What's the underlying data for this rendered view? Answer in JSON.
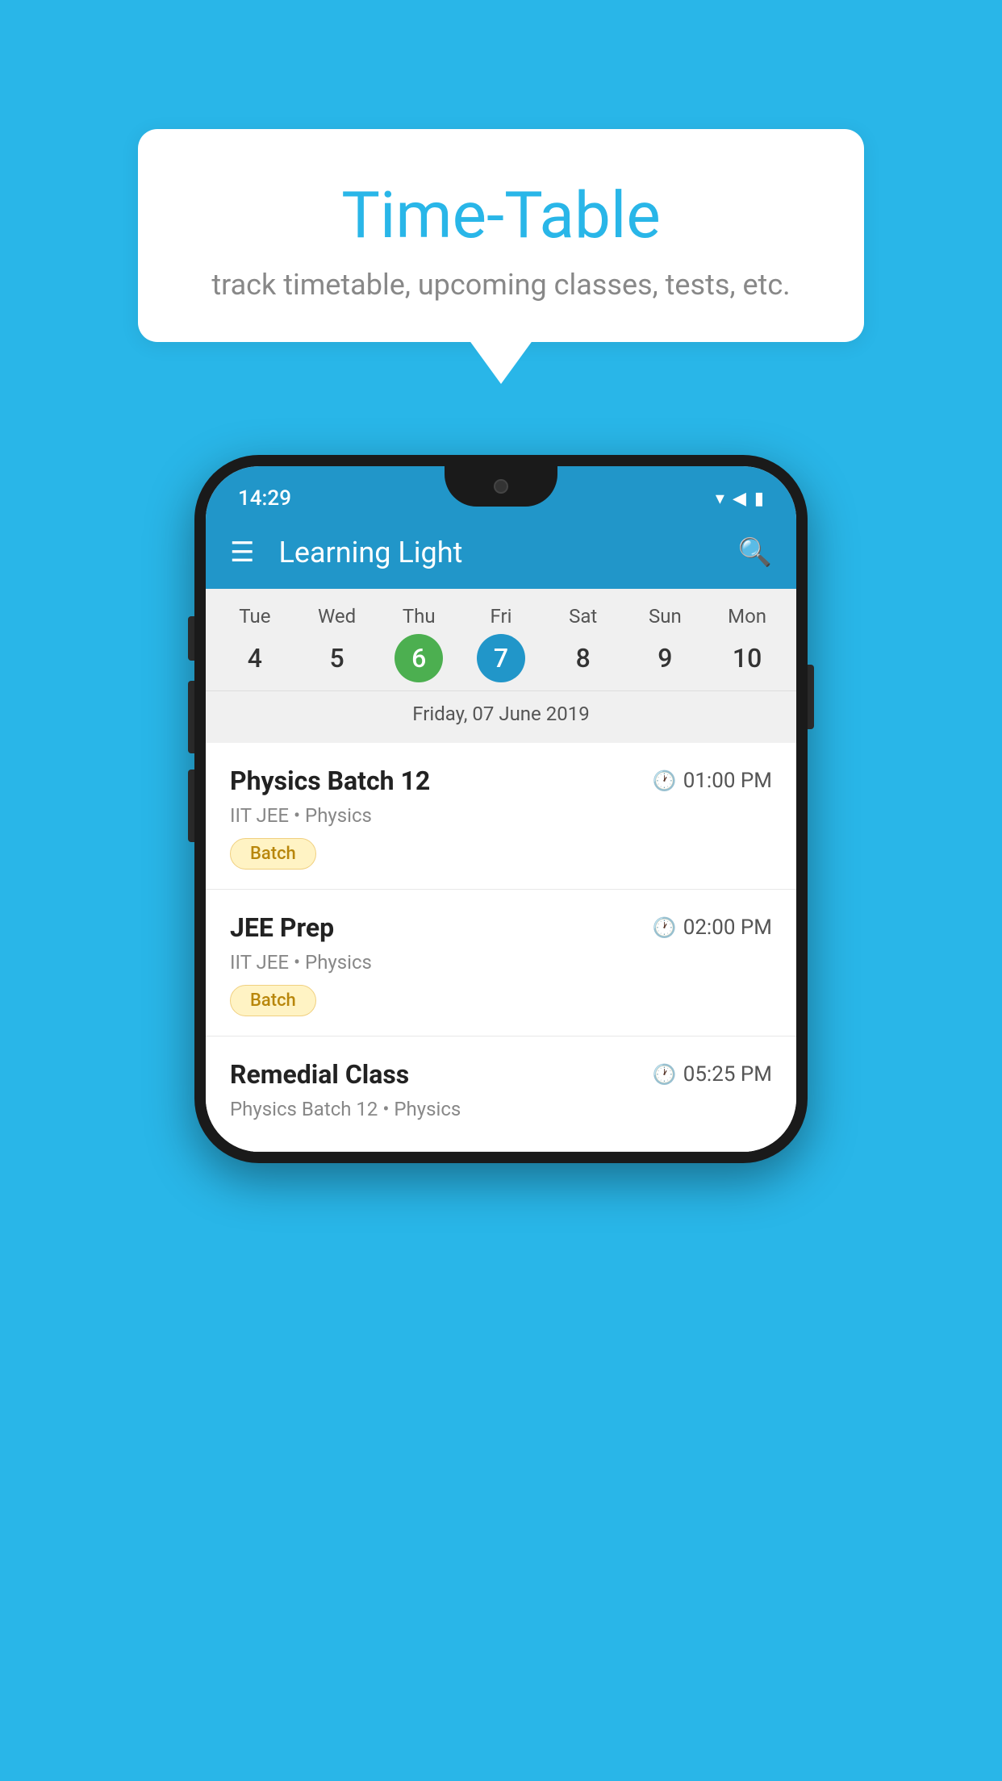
{
  "background_color": "#29B6E8",
  "tooltip": {
    "title": "Time-Table",
    "subtitle": "track timetable, upcoming classes, tests, etc."
  },
  "phone": {
    "status_bar": {
      "time": "14:29",
      "icons": "▼◀█"
    },
    "app_bar": {
      "title": "Learning Light"
    },
    "calendar": {
      "days": [
        {
          "name": "Tue",
          "number": "4",
          "state": "normal"
        },
        {
          "name": "Wed",
          "number": "5",
          "state": "normal"
        },
        {
          "name": "Thu",
          "number": "6",
          "state": "today"
        },
        {
          "name": "Fri",
          "number": "7",
          "state": "selected"
        },
        {
          "name": "Sat",
          "number": "8",
          "state": "normal"
        },
        {
          "name": "Sun",
          "number": "9",
          "state": "normal"
        },
        {
          "name": "Mon",
          "number": "10",
          "state": "normal"
        }
      ],
      "selected_date_label": "Friday, 07 June 2019"
    },
    "schedule": [
      {
        "title": "Physics Batch 12",
        "time": "01:00 PM",
        "subtitle": "IIT JEE • Physics",
        "badge": "Batch"
      },
      {
        "title": "JEE Prep",
        "time": "02:00 PM",
        "subtitle": "IIT JEE • Physics",
        "badge": "Batch"
      },
      {
        "title": "Remedial Class",
        "time": "05:25 PM",
        "subtitle": "Physics Batch 12 • Physics",
        "badge": null
      }
    ]
  }
}
